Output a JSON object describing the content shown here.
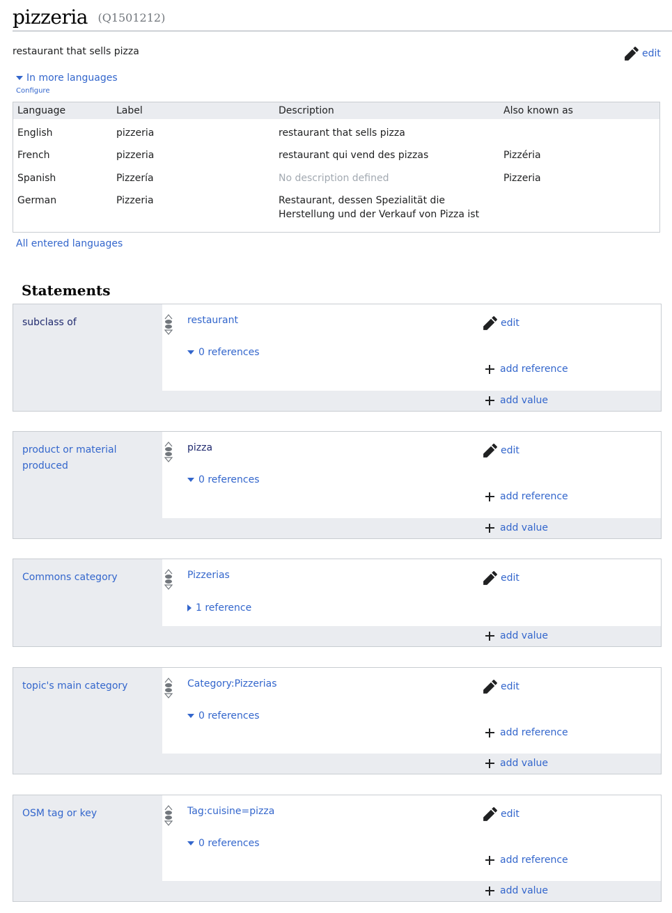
{
  "header": {
    "title": "pizzeria",
    "entity_id": "(Q1501212)"
  },
  "description": "restaurant that sells pizza",
  "edit_label": "edit",
  "languages": {
    "toggle_label": "In more languages",
    "configure_label": "Configure",
    "columns": [
      "Language",
      "Label",
      "Description",
      "Also known as"
    ],
    "rows": [
      {
        "language": "English",
        "label": "pizzeria",
        "description": "restaurant that sells pizza",
        "aliases": ""
      },
      {
        "language": "French",
        "label": "pizzeria",
        "description": "restaurant qui vend des pizzas",
        "aliases": "Pizzéria"
      },
      {
        "language": "Spanish",
        "label": "Pizzería",
        "description": "No description defined",
        "aliases": "Pizzeria"
      },
      {
        "language": "German",
        "label": "Pizzeria",
        "description": "Restaurant, dessen Spezialität die Herstellung und der Verkauf von Pizza ist",
        "aliases": ""
      }
    ],
    "all_languages_label": "All entered languages"
  },
  "statements": {
    "heading": "Statements",
    "add_reference_label": "add reference",
    "add_value_label": "add value",
    "groups": [
      {
        "property": "subclass of",
        "value": "restaurant",
        "references": "0 references"
      },
      {
        "property": "product or material produced",
        "value": "pizza",
        "references": "0 references"
      },
      {
        "property": "Commons category",
        "value": "Pizzerias",
        "references": "1 reference"
      },
      {
        "property": "topic's main category",
        "value": "Category:Pizzerias",
        "references": "0 references"
      },
      {
        "property": "OSM tag or key",
        "value": "Tag:cuisine=pizza",
        "references": "0 references"
      }
    ]
  },
  "colors": {
    "link": "#3366cc",
    "visited_link": "#202a6e",
    "panel_background": "#eaecf0",
    "border": "#c8ccd1",
    "placeholder": "#a2a9b1"
  },
  "icons": {
    "edit": "pencil-icon",
    "add": "plus-icon",
    "rank": "rank-selector-icon",
    "expand": "triangle-down-icon",
    "collapsed": "triangle-right-icon"
  }
}
